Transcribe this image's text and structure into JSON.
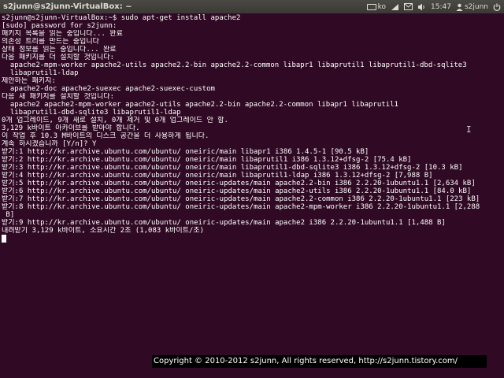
{
  "window": {
    "title": "s2junn@s2junn-VirtualBox: ~"
  },
  "panel": {
    "indicators": {
      "keyboard_icon": "keyboard-icon",
      "language": "ko",
      "network_icon": "network-icon",
      "mail_icon": "mail-icon",
      "volume_icon": "volume-icon",
      "time": "15:47",
      "user_icon": "user-icon",
      "user": "s2junn",
      "power_icon": "power-icon"
    }
  },
  "terminal": {
    "lines": [
      "s2junn@s2junn-VirtualBox:~$ sudo apt-get install apache2",
      "[sudo] password for s2junn:",
      "패키지 목록을 읽는 중입니다... 완료",
      "의존성 트리를 만드는 중입니다",
      "상태 정보를 읽는 중입니다... 완료",
      "다음 패키지를 더 설치할 것입니다:",
      "  apache2-mpm-worker apache2-utils apache2.2-bin apache2.2-common libapr1 libaprutil1 libaprutil1-dbd-sqlite3",
      "  libaprutil1-ldap",
      "제안하는 패키지:",
      "  apache2-doc apache2-suexec apache2-suexec-custom",
      "다음 새 패키지를 설치할 것입니다:",
      "  apache2 apache2-mpm-worker apache2-utils apache2.2-bin apache2.2-common libapr1 libaprutil1",
      "  libaprutil1-dbd-sqlite3 libaprutil1-ldap",
      "0개 업그레이드, 9개 새로 설치, 0개 제거 및 0개 업그레이드 안 함.",
      "3,129 k바이트 아카이브를 받아야 합니다.",
      "이 작업 후 10.3 M바이트의 디스크 공간을 더 사용하게 됩니다.",
      "계속 하시겠습니까 [Y/n]? Y",
      "받기:1 http://kr.archive.ubuntu.com/ubuntu/ oneiric/main libapr1 i386 1.4.5-1 [90.5 kB]",
      "받기:2 http://kr.archive.ubuntu.com/ubuntu/ oneiric/main libaprutil1 i386 1.3.12+dfsg-2 [75.4 kB]",
      "받기:3 http://kr.archive.ubuntu.com/ubuntu/ oneiric/main libaprutil1-dbd-sqlite3 i386 1.3.12+dfsg-2 [10.3 kB]",
      "받기:4 http://kr.archive.ubuntu.com/ubuntu/ oneiric/main libaprutil1-ldap i386 1.3.12+dfsg-2 [7,988 B]",
      "받기:5 http://kr.archive.ubuntu.com/ubuntu/ oneiric-updates/main apache2.2-bin i386 2.2.20-1ubuntu1.1 [2,634 kB]",
      "받기:6 http://kr.archive.ubuntu.com/ubuntu/ oneiric-updates/main apache2-utils i386 2.2.20-1ubuntu1.1 [84.0 kB]",
      "받기:7 http://kr.archive.ubuntu.com/ubuntu/ oneiric-updates/main apache2.2-common i386 2.2.20-1ubuntu1.1 [223 kB]",
      "받기:8 http://kr.archive.ubuntu.com/ubuntu/ oneiric-updates/main apache2-mpm-worker i386 2.2.20-1ubuntu1.1 [2,288",
      " B]",
      "받기:9 http://kr.archive.ubuntu.com/ubuntu/ oneiric-updates/main apache2 i386 2.2.20-1ubuntu1.1 [1,488 B]",
      "내려받기 3,129 k바이트, 소요시간 2초 (1,083 k바이트/초)"
    ]
  },
  "watermark": {
    "text": "Copyright © 2010-2012 s2junn, All rights reserved, http://s2junn.tistory.com/"
  }
}
